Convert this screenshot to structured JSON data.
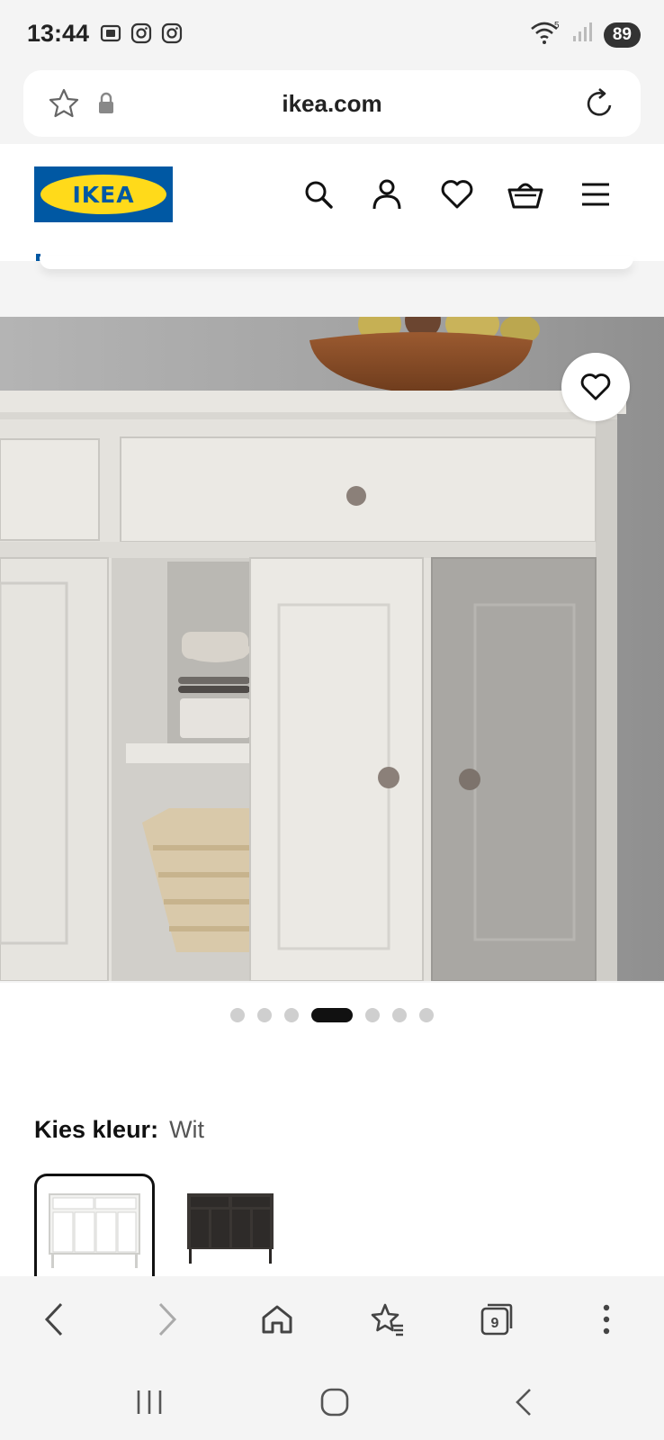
{
  "status_bar": {
    "time": "13:44",
    "battery": "89",
    "network": "5"
  },
  "url_bar": {
    "domain": "ikea.com"
  },
  "header": {
    "logo_text": "IKEA"
  },
  "carousel": {
    "dot_count": 7,
    "active_index": 3
  },
  "color_picker": {
    "label": "Kies kleur:",
    "value": "Wit",
    "swatches": [
      "white",
      "dark"
    ]
  },
  "tabs": {
    "count": "9"
  },
  "colors": {
    "brand_blue": "#0058a3",
    "brand_yellow": "#ffda1a",
    "dark_swatch": "#3a3633"
  }
}
